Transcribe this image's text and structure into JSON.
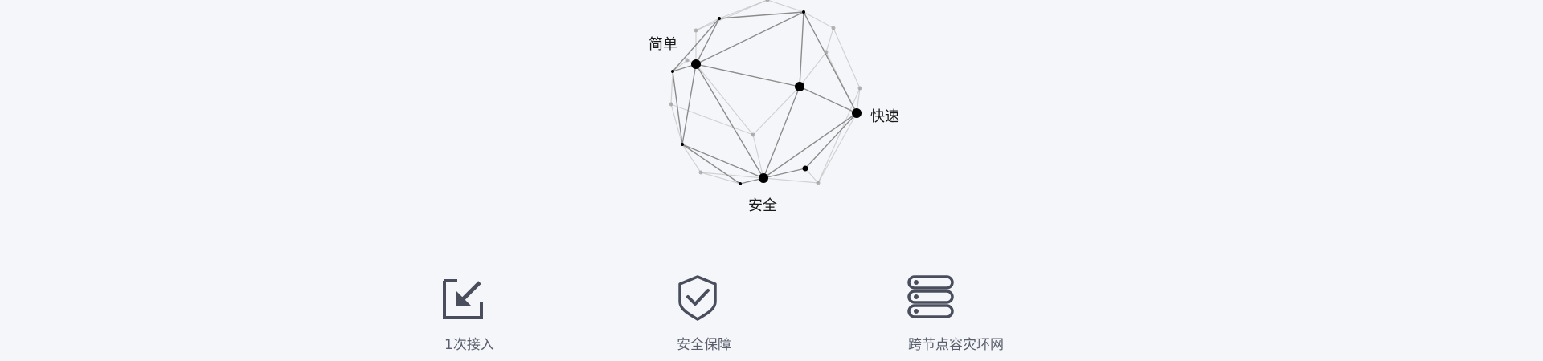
{
  "graph": {
    "labels": {
      "simple": "简单",
      "fast": "快速",
      "secure": "安全"
    }
  },
  "features": [
    {
      "label": "1次接入",
      "icon": "import-arrow-icon"
    },
    {
      "label": "安全保障",
      "icon": "shield-check-icon"
    },
    {
      "label": "跨节点容灾环网",
      "icon": "server-stack-icon"
    }
  ],
  "colors": {
    "background": "#f4f6fa",
    "icon": "#4a4e5c",
    "node": "#000000",
    "edge": "#8c8c8c"
  }
}
